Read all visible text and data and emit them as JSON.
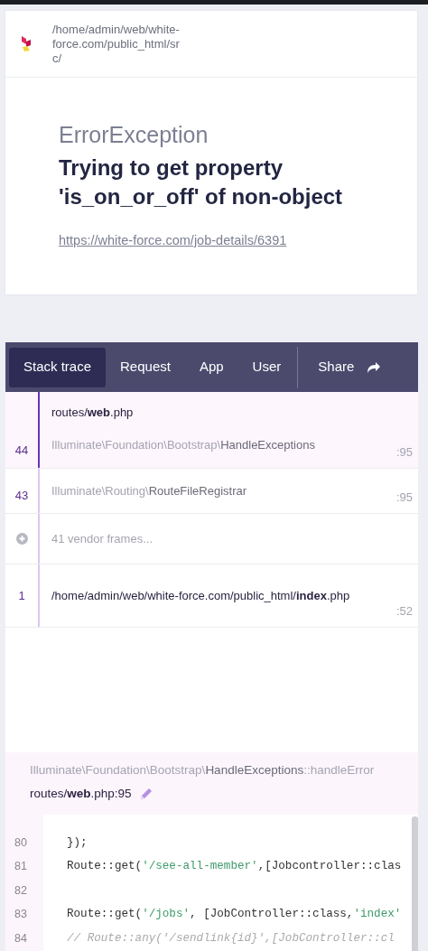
{
  "header": {
    "path": "/home/admin/web/white-force.com/public_html/src/"
  },
  "error": {
    "type": "ErrorException",
    "message": "Trying to get property 'is_on_or_off' of non-object",
    "url": "https://white-force.com/job-details/6391"
  },
  "tabs": [
    {
      "label": "Stack trace",
      "selected": true
    },
    {
      "label": "Request",
      "selected": false
    },
    {
      "label": "App",
      "selected": false
    },
    {
      "label": "User",
      "selected": false
    }
  ],
  "share": {
    "label": "Share"
  },
  "frames": [
    {
      "kind": "frame",
      "number": "44",
      "file": "routes/**web**.php",
      "namespace": "Illuminate\\Foundation\\Bootstrap\\",
      "class": "HandleExceptions",
      "line": ":95",
      "selected": true
    },
    {
      "kind": "frame",
      "number": "43",
      "namespace": "Illuminate\\Routing\\",
      "class": "RouteFileRegistrar",
      "line": ":95",
      "selected": false
    },
    {
      "kind": "vendor",
      "label": "41 vendor frames..."
    },
    {
      "kind": "frame",
      "number": "1",
      "file": "/home/admin/web/white-force.com/public_html/**index**.php",
      "line": ":52",
      "selected": false
    }
  ],
  "snippet": {
    "namespace": "Illuminate\\Foundation\\Bootstrap\\",
    "class": "HandleExceptions",
    "method": "::handleError",
    "file": "routes/**web**.php:95",
    "lines": [
      {
        "number": "80",
        "tokens": [
          {
            "kind": "plain",
            "text": "});"
          }
        ]
      },
      {
        "number": "81",
        "tokens": [
          {
            "kind": "plain",
            "text": "Route::get("
          },
          {
            "kind": "string",
            "text": "'/see-all-member'"
          },
          {
            "kind": "plain",
            "text": ",[Jobcontroller::clas"
          }
        ]
      },
      {
        "number": "82"
      },
      {
        "number": "83",
        "tokens": [
          {
            "kind": "plain",
            "text": "Route::get("
          },
          {
            "kind": "string",
            "text": "'/jobs'"
          },
          {
            "kind": "plain",
            "text": ", [JobController::class,"
          },
          {
            "kind": "string",
            "text": "'index'"
          }
        ]
      },
      {
        "number": "84",
        "tokens": [
          {
            "kind": "comment",
            "text": "// Route::any('/sendlink{id}',[JobController::cl"
          }
        ]
      }
    ]
  }
}
